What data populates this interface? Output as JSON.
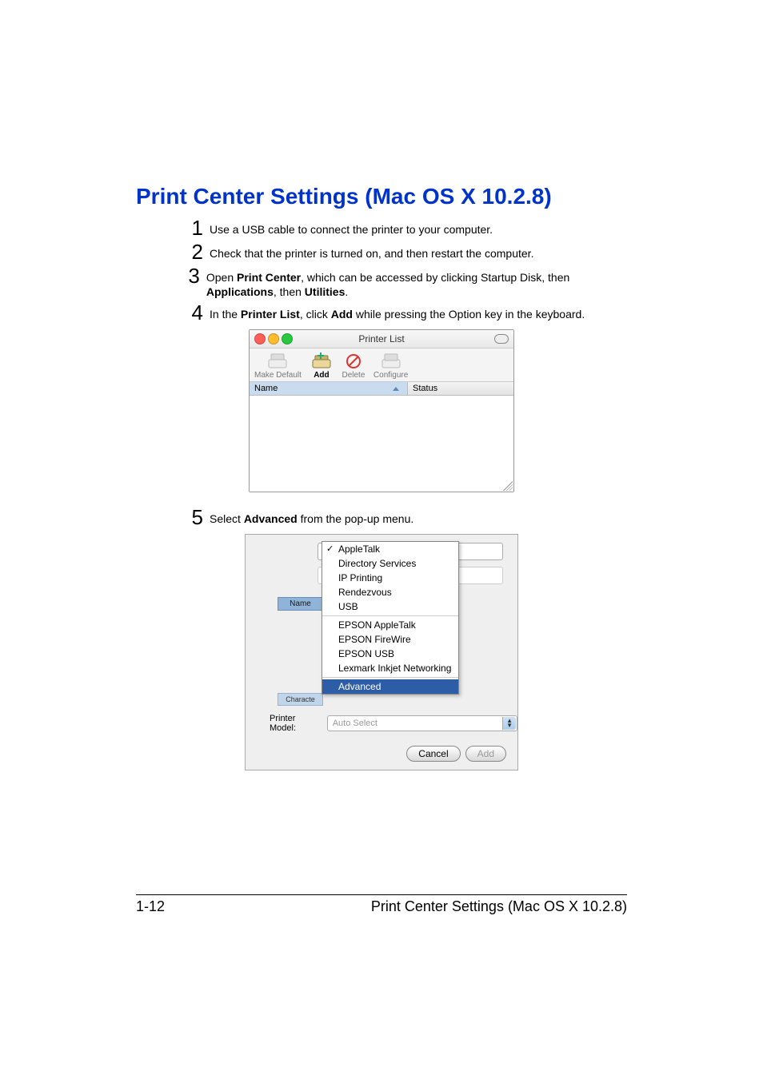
{
  "heading": "Print Center Settings (Mac OS X 10.2.8)",
  "steps": {
    "s1": {
      "num": "1",
      "text": "Use a USB cable to connect the printer to your computer."
    },
    "s2": {
      "num": "2",
      "text": "Check that the printer is turned on, and then restart the computer."
    },
    "s3": {
      "num": "3",
      "pre": "Open ",
      "b1": "Print Center",
      "mid1": ", which can be accessed by clicking Startup Disk, then ",
      "b2": "Applications",
      "mid2": ", then ",
      "b3": "Utilities",
      "post": "."
    },
    "s4": {
      "num": "4",
      "pre": "In the ",
      "b1": "Printer List",
      "mid1": ", click ",
      "b2": "Add",
      "post": " while pressing the Option key in the key­board."
    },
    "s5": {
      "num": "5",
      "pre": "Select ",
      "b1": "Advanced",
      "post": " from the pop-up menu."
    }
  },
  "printer_list_window": {
    "title": "Printer List",
    "toolbar": {
      "make_default": "Make Default",
      "add": "Add",
      "delete": "Delete",
      "configure": "Configure"
    },
    "columns": {
      "name": "Name",
      "status": "Status"
    }
  },
  "popup_sheet": {
    "name_header": "Name",
    "char_header": "Characte",
    "menu": {
      "apple_talk": "AppleTalk",
      "directory_services": "Directory Services",
      "ip_printing": "IP Printing",
      "rendezvous": "Rendezvous",
      "usb": "USB",
      "epson_appletalk": "EPSON AppleTalk",
      "epson_firewire": "EPSON FireWire",
      "epson_usb": "EPSON USB",
      "lexmark": "Lexmark Inkjet Networking",
      "advanced": "Advanced"
    },
    "printer_model_label": "Printer Model:",
    "printer_model_value": "Auto Select",
    "cancel": "Cancel",
    "add": "Add"
  },
  "footer": {
    "page": "1-12",
    "title": "Print Center Settings (Mac OS X 10.2.8)"
  }
}
